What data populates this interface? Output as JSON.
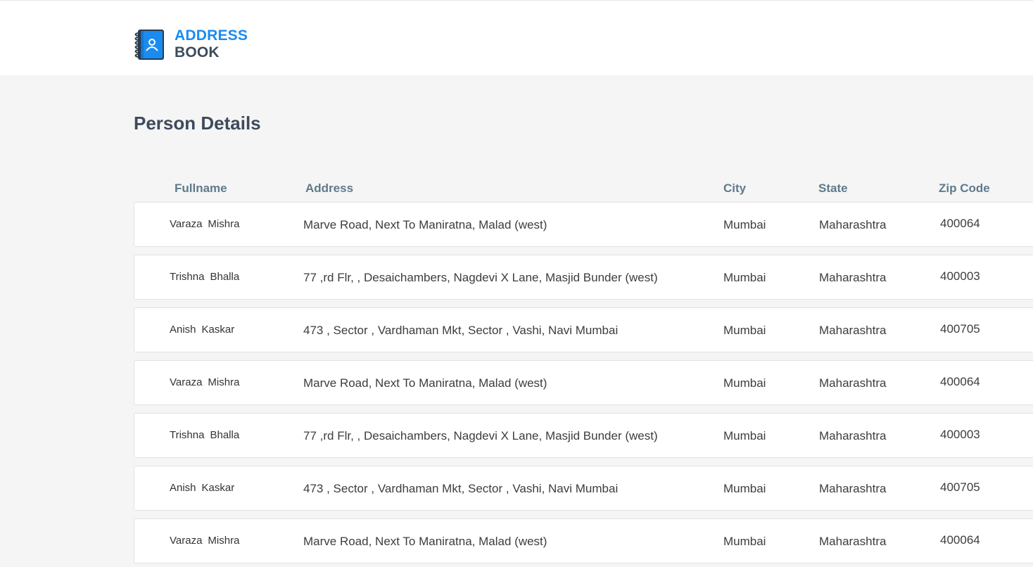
{
  "brand": {
    "line1": "ADDRESS",
    "line2": "BOOK",
    "icon": "address-book-icon",
    "accent": "#1a8cf0",
    "dark": "#3d4a5c"
  },
  "page": {
    "title": "Person Details"
  },
  "table": {
    "columns": [
      "Fullname",
      "Address",
      "City",
      "State",
      "Zip Code"
    ],
    "rows": [
      {
        "first": "Varaza",
        "last": "Mishra",
        "address": "Marve Road, Next To Maniratna, Malad (west)",
        "city": "Mumbai",
        "state": "Maharashtra",
        "zip": "400064"
      },
      {
        "first": "Trishna",
        "last": "Bhalla",
        "address": "77 ,rd Flr, , Desaichambers, Nagdevi X Lane, Masjid Bunder (west)",
        "city": "Mumbai",
        "state": "Maharashtra",
        "zip": "400003"
      },
      {
        "first": "Anish",
        "last": "Kaskar",
        "address": "473 , Sector , Vardhaman Mkt, Sector , Vashi, Navi Mumbai",
        "city": "Mumbai",
        "state": "Maharashtra",
        "zip": "400705"
      },
      {
        "first": "Varaza",
        "last": "Mishra",
        "address": "Marve Road, Next To Maniratna, Malad (west)",
        "city": "Mumbai",
        "state": "Maharashtra",
        "zip": "400064"
      },
      {
        "first": "Trishna",
        "last": "Bhalla",
        "address": "77 ,rd Flr, , Desaichambers, Nagdevi X Lane, Masjid Bunder (west)",
        "city": "Mumbai",
        "state": "Maharashtra",
        "zip": "400003"
      },
      {
        "first": "Anish",
        "last": "Kaskar",
        "address": "473 , Sector , Vardhaman Mkt, Sector , Vashi, Navi Mumbai",
        "city": "Mumbai",
        "state": "Maharashtra",
        "zip": "400705"
      },
      {
        "first": "Varaza",
        "last": "Mishra",
        "address": "Marve Road, Next To Maniratna, Malad (west)",
        "city": "Mumbai",
        "state": "Maharashtra",
        "zip": "400064"
      }
    ]
  }
}
